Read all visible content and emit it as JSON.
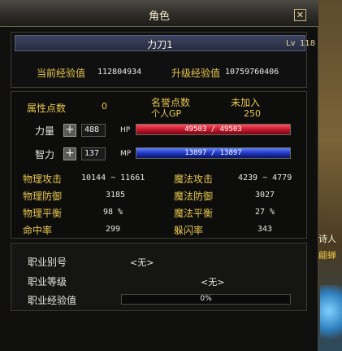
{
  "window": {
    "title": "角色",
    "close_icon": "close-icon"
  },
  "character": {
    "name": "力刀1",
    "level_label": "Lv",
    "level": "118"
  },
  "experience": {
    "current_label": "当前经验值",
    "current_value": "112804934",
    "upgrade_label": "升级经验值",
    "upgrade_value": "10759760406"
  },
  "attributes": {
    "points_label": "属性点数",
    "points_value": "0",
    "honor_label": "名誉点数",
    "honor_value": "未加入",
    "gp_label": "个人GP",
    "gp_value": "250"
  },
  "stats": {
    "strength_label": "力量",
    "strength_value": "488",
    "intellect_label": "智力",
    "intellect_value": "137"
  },
  "bars": {
    "hp_label": "HP",
    "hp_text": "49503 / 49503",
    "hp_fraction": 1.0,
    "hp_color": "#c81830",
    "mp_label": "MP",
    "mp_text": "13897 / 13897",
    "mp_fraction": 1.0,
    "mp_color": "#2038c0"
  },
  "combat": {
    "phys_atk_label": "物理攻击",
    "phys_atk_value": "10144 ~ 11661",
    "mag_atk_label": "魔法攻击",
    "mag_atk_value": "4239 ~ 4779",
    "phys_def_label": "物理防御",
    "phys_def_value": "3185",
    "mag_def_label": "魔法防御",
    "mag_def_value": "3027",
    "phys_bal_label": "物理平衡",
    "phys_bal_value": "98 %",
    "mag_bal_label": "魔法平衡",
    "mag_bal_value": "27 %",
    "hit_label": "命中率",
    "hit_value": "299",
    "dodge_label": "躲闪率",
    "dodge_value": "343"
  },
  "job": {
    "class_label": "职业别号",
    "class_value": "<无>",
    "level_label": "职业等级",
    "level_value": "<无>",
    "exp_label": "职业经验值",
    "exp_text": "0%",
    "exp_fraction": 0
  },
  "background": {
    "npc1": "诗人",
    "npc2": "翩蝉"
  }
}
